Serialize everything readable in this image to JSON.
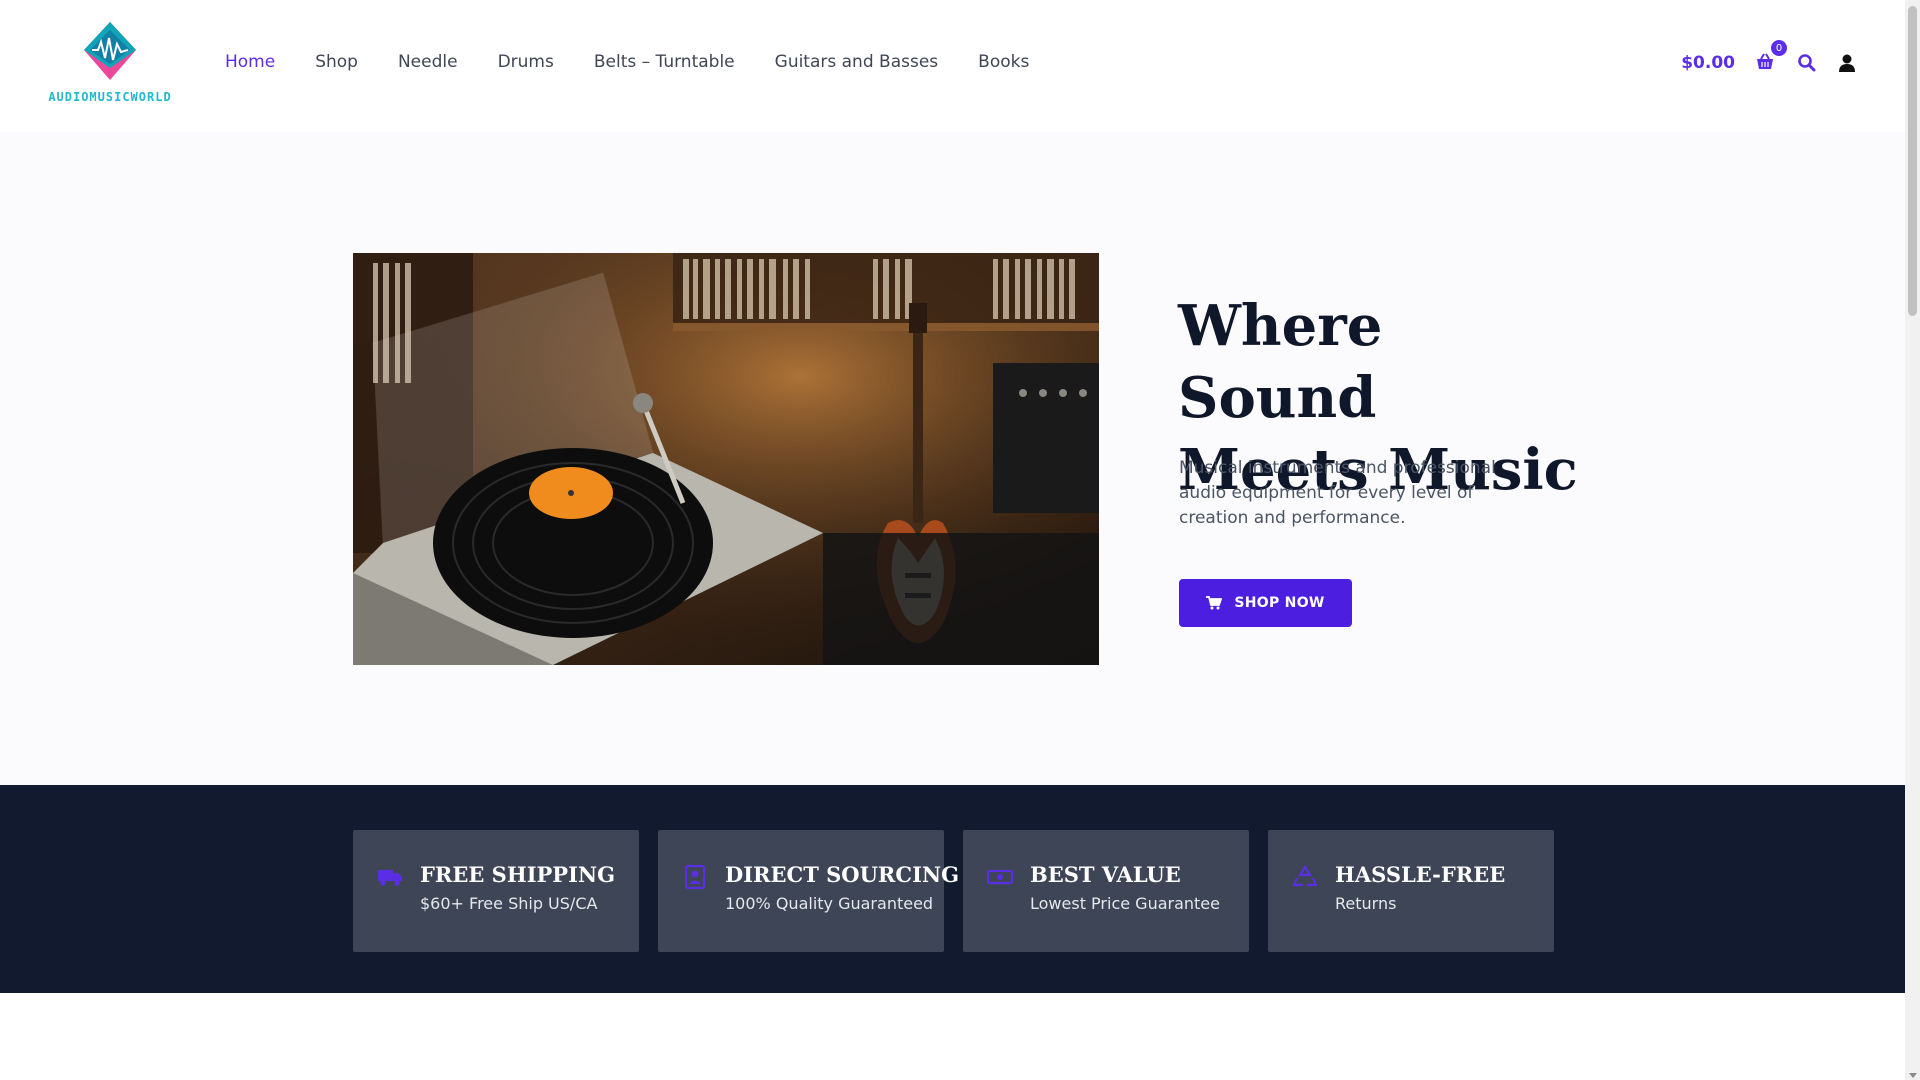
{
  "brand": {
    "name": "AUDIOMUSICWORLD",
    "accent": "#5b2ee6"
  },
  "nav": {
    "items": [
      {
        "label": "Home",
        "active": true
      },
      {
        "label": "Shop",
        "active": false
      },
      {
        "label": "Needle",
        "active": false
      },
      {
        "label": "Drums",
        "active": false
      },
      {
        "label": "Belts – Turntable",
        "active": false
      },
      {
        "label": "Guitars and Basses",
        "active": false
      },
      {
        "label": "Books",
        "active": false
      }
    ]
  },
  "header": {
    "cart_total": "$0.00",
    "cart_count": "0"
  },
  "hero": {
    "title_line1": "Where Sound",
    "title_line2": "Meets Music",
    "description": "Musical instruments and professional audio equipment for every level of creation and performance.",
    "cta_label": "SHOP NOW"
  },
  "features": [
    {
      "title": "FREE SHIPPING",
      "subtitle": "$60+ Free Ship US/CA",
      "icon": "truck-icon"
    },
    {
      "title": "DIRECT SOURCING",
      "subtitle": "100% Quality Guaranteed",
      "icon": "badge-icon"
    },
    {
      "title": "BEST VALUE",
      "subtitle": "Lowest Price Guarantee",
      "icon": "money-icon"
    },
    {
      "title": "HASSLE-FREE",
      "subtitle": "Returns",
      "icon": "recycle-icon"
    }
  ]
}
